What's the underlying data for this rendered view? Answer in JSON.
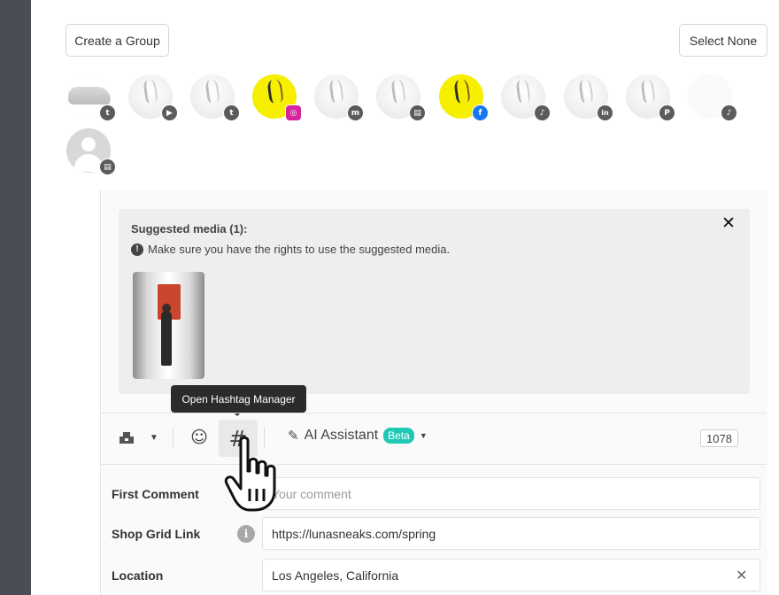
{
  "groups": {
    "create_label": "Create a Group",
    "select_none_label": "Select None"
  },
  "accounts": [
    {
      "platform": "twitter",
      "badge": "t",
      "style": "shoe"
    },
    {
      "platform": "youtube",
      "badge": "▶",
      "style": "grey"
    },
    {
      "platform": "twitter",
      "badge": "t",
      "style": "grey"
    },
    {
      "platform": "instagram",
      "badge": "◎",
      "style": "yellow"
    },
    {
      "platform": "mastodon",
      "badge": "m",
      "style": "grey"
    },
    {
      "platform": "google-business",
      "badge": "▤",
      "style": "grey"
    },
    {
      "platform": "facebook",
      "badge": "f",
      "style": "yellow"
    },
    {
      "platform": "tiktok",
      "badge": "♪",
      "style": "grey"
    },
    {
      "platform": "linkedin",
      "badge": "in",
      "style": "grey"
    },
    {
      "platform": "pinterest",
      "badge": "P",
      "style": "grey"
    },
    {
      "platform": "tiktok",
      "badge": "♪",
      "style": "faint"
    },
    {
      "platform": "google-business",
      "badge": "▤",
      "style": "person"
    }
  ],
  "suggested": {
    "title": "Suggested media (1):",
    "note": "Make sure you have the rights to use the suggested media.",
    "close": "✕"
  },
  "tooltip": "Open Hashtag Manager",
  "toolbar": {
    "ai_label": "AI Assistant",
    "beta_label": "Beta",
    "char_count": "1078",
    "hash_symbol": "#",
    "emoji_symbol": "☺",
    "wand_symbol": "✎"
  },
  "fields": {
    "first_comment_label": "First Comment",
    "first_comment_placeholder": "Your comment",
    "shop_label": "Shop Grid Link",
    "shop_value": "https://lunasneaks.com/spring",
    "location_label": "Location",
    "location_value": "Los Angeles, California",
    "clear": "✕"
  },
  "icons": {
    "info": "i",
    "alert": "!"
  }
}
